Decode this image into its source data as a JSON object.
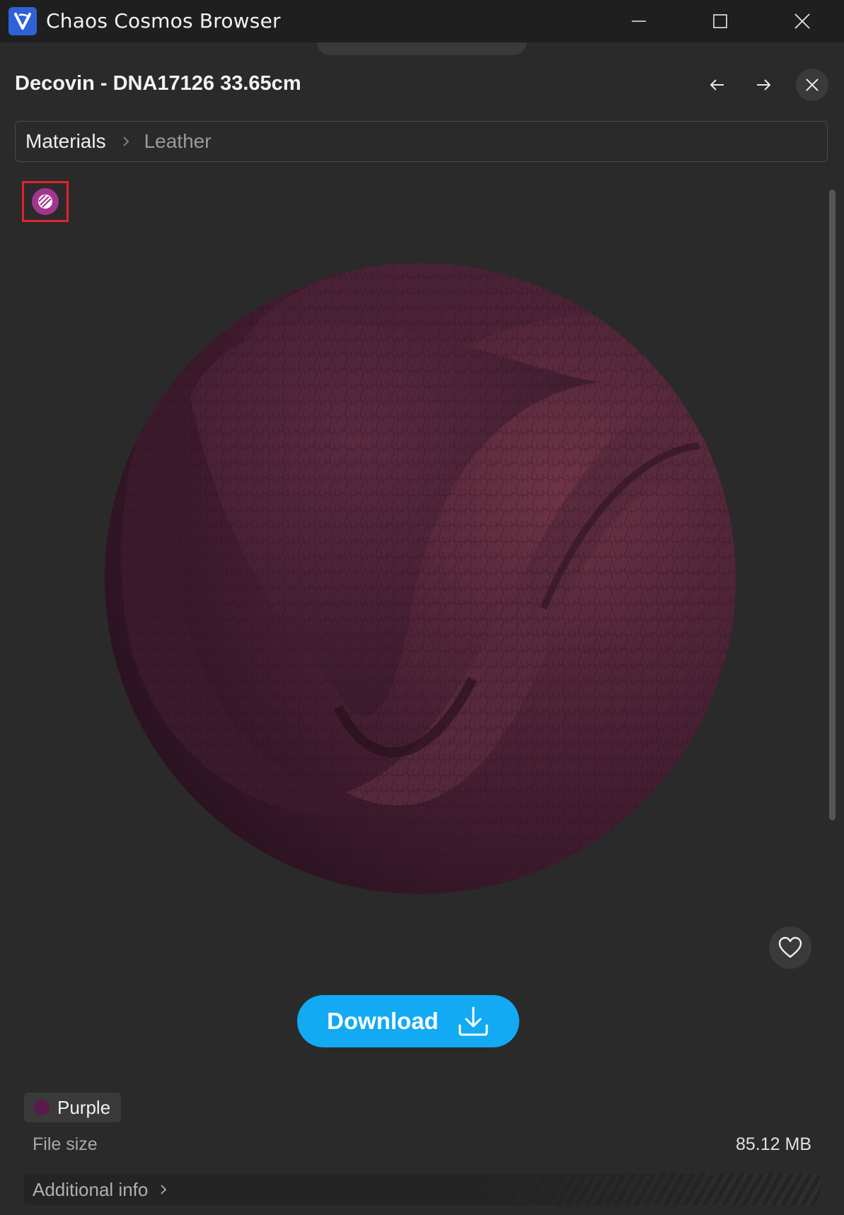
{
  "window": {
    "title": "Chaos Cosmos Browser",
    "icon": "chaos-v-logo-icon"
  },
  "header": {
    "title": "Decovin - DNA17126 33.65cm"
  },
  "breadcrumb": {
    "items": [
      "Materials",
      "Leather"
    ]
  },
  "renderer_badge": {
    "icon": "renderer-icon",
    "color": "#a4358f"
  },
  "preview": {
    "subject": "leather-material-sphere",
    "color": "#4a2236"
  },
  "actions": {
    "download_label": "Download",
    "accent_color": "#12aaf3"
  },
  "tags": [
    {
      "label": "Purple",
      "color": "#5a1a4e"
    }
  ],
  "details": {
    "file_size_label": "File size",
    "file_size_value": "85.12 MB",
    "additional_info_label": "Additional info"
  }
}
